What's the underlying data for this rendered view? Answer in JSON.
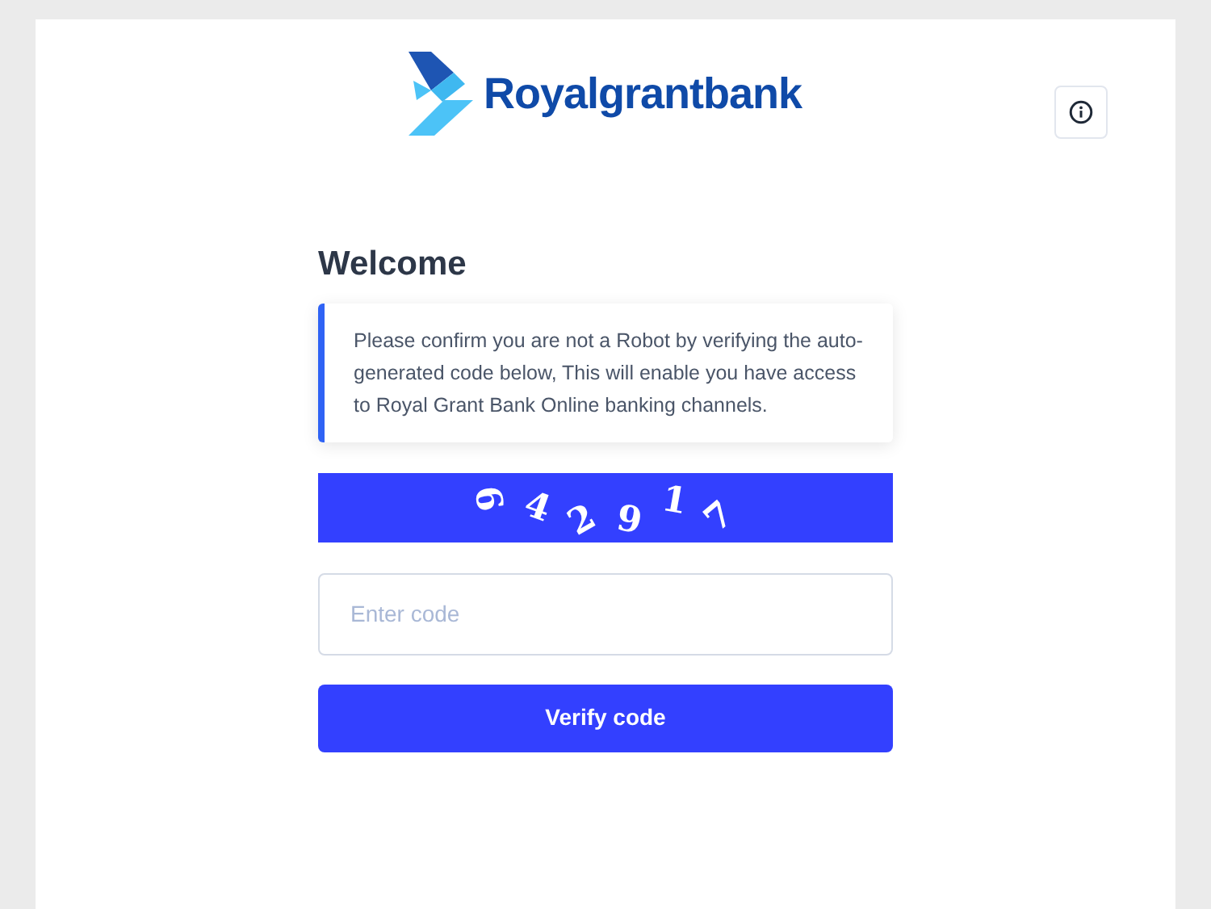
{
  "brand": {
    "name": "Royalgrantbank"
  },
  "heading": "Welcome",
  "notice": "Please confirm you are not a Robot by verifying the auto-generated code below, This will enable you have access to Royal Grant Bank Online banking channels.",
  "captcha": {
    "characters": [
      "9",
      "4",
      "2",
      "9",
      "1",
      "7"
    ]
  },
  "code_field": {
    "placeholder": "Enter code"
  },
  "submit": {
    "label": "Verify code"
  }
}
